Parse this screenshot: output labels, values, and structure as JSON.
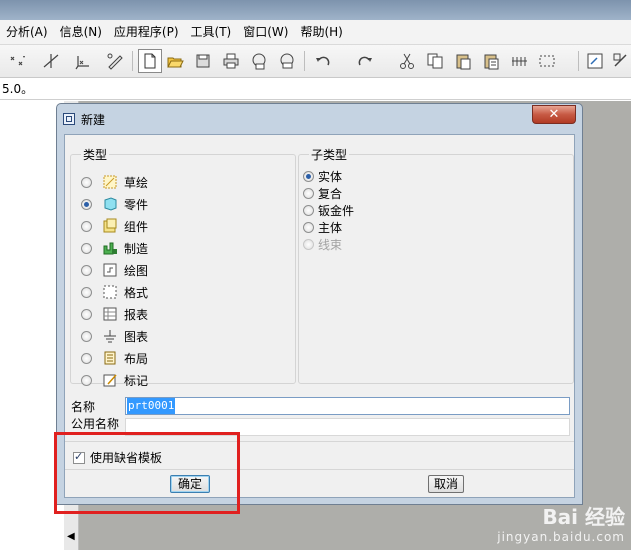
{
  "menubar": {
    "items": [
      "分析(A)",
      "信息(N)",
      "应用程序(P)",
      "工具(T)",
      "窗口(W)",
      "帮助(H)"
    ]
  },
  "toolbar": {
    "icons": [
      "datum-points-icon",
      "axis-icon",
      "coordinate-icon",
      "sketch-tool-icon",
      "new-file-icon",
      "open-folder-icon",
      "save-icon",
      "print-icon",
      "email-icon",
      "attach-email-icon",
      "undo-icon",
      "redo-icon",
      "cut-icon",
      "copy-icon",
      "paste-icon",
      "paste-special-icon",
      "regenerate-icon",
      "select-box-icon",
      "model-tree-icon",
      "view-icon"
    ]
  },
  "message_bar": {
    "text": "5.0。"
  },
  "dialog": {
    "title": "新建",
    "close_label": "✕",
    "type_group": {
      "legend": "类型",
      "options": [
        {
          "label": "草绘",
          "icon": "sketch-icon",
          "selected": false
        },
        {
          "label": "零件",
          "icon": "part-icon",
          "selected": true
        },
        {
          "label": "组件",
          "icon": "assembly-icon",
          "selected": false
        },
        {
          "label": "制造",
          "icon": "manufacturing-icon",
          "selected": false
        },
        {
          "label": "绘图",
          "icon": "drawing-icon",
          "selected": false
        },
        {
          "label": "格式",
          "icon": "format-icon",
          "selected": false
        },
        {
          "label": "报表",
          "icon": "report-icon",
          "selected": false
        },
        {
          "label": "图表",
          "icon": "diagram-icon",
          "selected": false
        },
        {
          "label": "布局",
          "icon": "layout-icon",
          "selected": false
        },
        {
          "label": "标记",
          "icon": "markup-icon",
          "selected": false
        }
      ]
    },
    "subtype_group": {
      "legend": "子类型",
      "options": [
        {
          "label": "实体",
          "selected": true,
          "enabled": true
        },
        {
          "label": "复合",
          "selected": false,
          "enabled": true
        },
        {
          "label": "钣金件",
          "selected": false,
          "enabled": true
        },
        {
          "label": "主体",
          "selected": false,
          "enabled": true
        },
        {
          "label": "线束",
          "selected": false,
          "enabled": false
        }
      ]
    },
    "name_label": "名称",
    "name_value": "prt0001",
    "common_name_label": "公用名称",
    "common_name_value": "",
    "use_default_template_label": "使用缺省模板",
    "use_default_template_checked": true,
    "ok_label": "确定",
    "cancel_label": "取消"
  },
  "watermark": {
    "line1": "Bai 经验",
    "line2": "jingyan.baidu.com"
  },
  "colors": {
    "highlight_box": "#e0201f",
    "selection": "#3399ff"
  }
}
